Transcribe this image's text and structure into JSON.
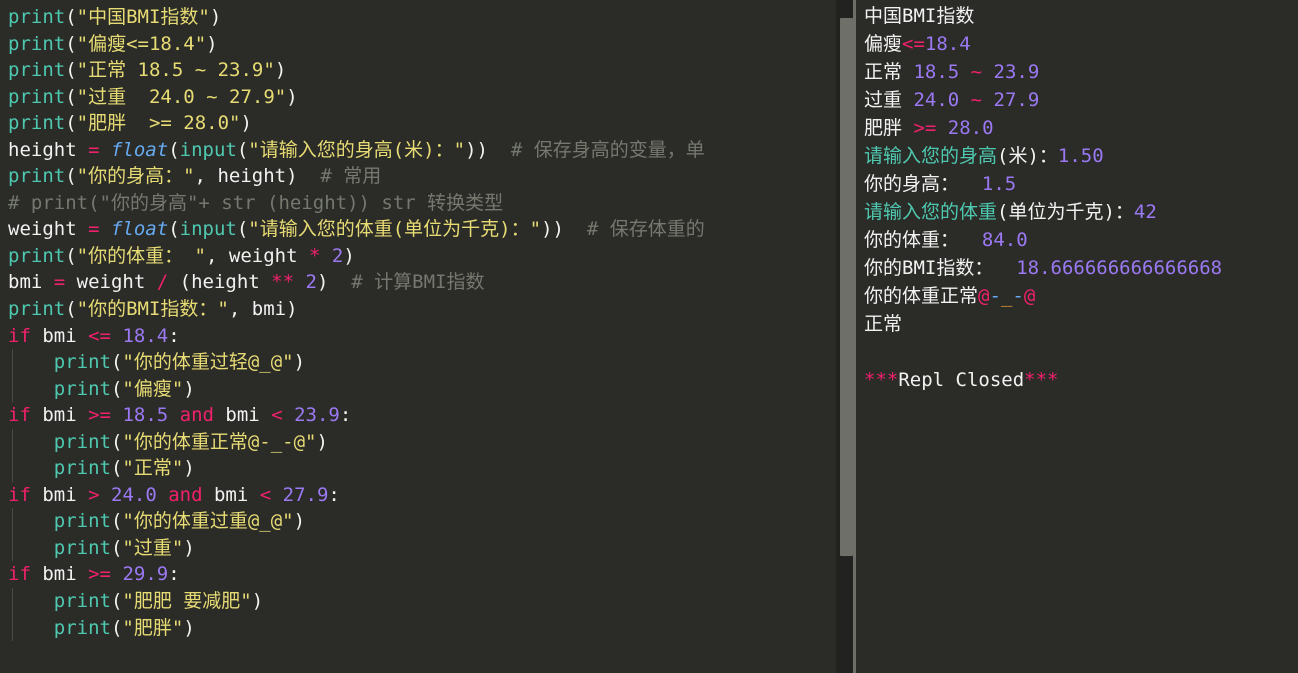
{
  "window": {
    "theme": "dark",
    "colors": {
      "background": "#2b2b28",
      "function": "#4ec9b0",
      "string": "#e7db74",
      "number": "#9a79f2",
      "operator": "#f0216c",
      "comment": "#74786e",
      "cast": "#66aaf0",
      "text": "#f2f2f2",
      "scrollbar": "#6f6f69"
    }
  },
  "editor": {
    "name": "python-code-editor",
    "language": "Python",
    "lines": [
      {
        "n": 1,
        "indent": 0,
        "tokens": [
          {
            "c": "fn",
            "t": "print"
          },
          {
            "c": "punc",
            "t": "("
          },
          {
            "c": "str",
            "t": "\"中国BMI指数\""
          },
          {
            "c": "punc",
            "t": ")"
          }
        ]
      },
      {
        "n": 2,
        "indent": 0,
        "tokens": [
          {
            "c": "fn",
            "t": "print"
          },
          {
            "c": "punc",
            "t": "("
          },
          {
            "c": "str",
            "t": "\"偏瘦<=18.4\""
          },
          {
            "c": "punc",
            "t": ")"
          }
        ]
      },
      {
        "n": 3,
        "indent": 0,
        "tokens": [
          {
            "c": "fn",
            "t": "print"
          },
          {
            "c": "punc",
            "t": "("
          },
          {
            "c": "str",
            "t": "\"正常 18.5 ~ 23.9\""
          },
          {
            "c": "punc",
            "t": ")"
          }
        ]
      },
      {
        "n": 4,
        "indent": 0,
        "tokens": [
          {
            "c": "fn",
            "t": "print"
          },
          {
            "c": "punc",
            "t": "("
          },
          {
            "c": "str",
            "t": "\"过重  24.0 ~ 27.9\""
          },
          {
            "c": "punc",
            "t": ")"
          }
        ]
      },
      {
        "n": 5,
        "indent": 0,
        "tokens": [
          {
            "c": "fn",
            "t": "print"
          },
          {
            "c": "punc",
            "t": "("
          },
          {
            "c": "str",
            "t": "\"肥胖  >= 28.0\""
          },
          {
            "c": "punc",
            "t": ")"
          }
        ]
      },
      {
        "n": 6,
        "indent": 0,
        "tokens": [
          {
            "c": "var",
            "t": "height "
          },
          {
            "c": "op",
            "t": "="
          },
          {
            "c": "plain",
            "t": " "
          },
          {
            "c": "cast",
            "t": "float"
          },
          {
            "c": "punc",
            "t": "("
          },
          {
            "c": "fn",
            "t": "input"
          },
          {
            "c": "punc",
            "t": "("
          },
          {
            "c": "str",
            "t": "\"请输入您的身高(米)："
          },
          {
            "c": "str",
            "t": "\""
          },
          {
            "c": "punc",
            "t": "))"
          },
          {
            "c": "cmt",
            "t": "  # 保存身高的变量，单"
          }
        ]
      },
      {
        "n": 7,
        "indent": 0,
        "tokens": [
          {
            "c": "fn",
            "t": "print"
          },
          {
            "c": "punc",
            "t": "("
          },
          {
            "c": "str",
            "t": "\"你的身高：\""
          },
          {
            "c": "punc",
            "t": ", "
          },
          {
            "c": "var",
            "t": "height"
          },
          {
            "c": "punc",
            "t": ")"
          },
          {
            "c": "cmt",
            "t": "  # 常用"
          }
        ]
      },
      {
        "n": 8,
        "indent": 0,
        "tokens": [
          {
            "c": "cmt",
            "t": "# print(\"你的身高\"+ str (height)) str 转换类型"
          }
        ]
      },
      {
        "n": 9,
        "indent": 0,
        "tokens": [
          {
            "c": "var",
            "t": "weight "
          },
          {
            "c": "op",
            "t": "="
          },
          {
            "c": "plain",
            "t": " "
          },
          {
            "c": "cast",
            "t": "float"
          },
          {
            "c": "punc",
            "t": "("
          },
          {
            "c": "fn",
            "t": "input"
          },
          {
            "c": "punc",
            "t": "("
          },
          {
            "c": "str",
            "t": "\"请输入您的体重(单位为千克)：\""
          },
          {
            "c": "punc",
            "t": "))"
          },
          {
            "c": "cmt",
            "t": "  # 保存体重的"
          }
        ]
      },
      {
        "n": 10,
        "indent": 0,
        "tokens": [
          {
            "c": "fn",
            "t": "print"
          },
          {
            "c": "punc",
            "t": "("
          },
          {
            "c": "str",
            "t": "\"你的体重： \""
          },
          {
            "c": "punc",
            "t": ", "
          },
          {
            "c": "var",
            "t": "weight "
          },
          {
            "c": "op",
            "t": "*"
          },
          {
            "c": "plain",
            "t": " "
          },
          {
            "c": "num",
            "t": "2"
          },
          {
            "c": "punc",
            "t": ")"
          }
        ]
      },
      {
        "n": 11,
        "indent": 0,
        "tokens": [
          {
            "c": "var",
            "t": "bmi "
          },
          {
            "c": "op",
            "t": "="
          },
          {
            "c": "var",
            "t": " weight "
          },
          {
            "c": "op",
            "t": "/"
          },
          {
            "c": "punc",
            "t": " ("
          },
          {
            "c": "var",
            "t": "height "
          },
          {
            "c": "op",
            "t": "**"
          },
          {
            "c": "plain",
            "t": " "
          },
          {
            "c": "num",
            "t": "2"
          },
          {
            "c": "punc",
            "t": ")"
          },
          {
            "c": "cmt",
            "t": "  # 计算BMI指数"
          }
        ]
      },
      {
        "n": 12,
        "indent": 0,
        "tokens": [
          {
            "c": "fn",
            "t": "print"
          },
          {
            "c": "punc",
            "t": "("
          },
          {
            "c": "str",
            "t": "\"你的BMI指数：\""
          },
          {
            "c": "punc",
            "t": ", "
          },
          {
            "c": "var",
            "t": "bmi"
          },
          {
            "c": "punc",
            "t": ")"
          }
        ]
      },
      {
        "n": 13,
        "indent": 0,
        "tokens": [
          {
            "c": "kw",
            "t": "if"
          },
          {
            "c": "var",
            "t": " bmi "
          },
          {
            "c": "op",
            "t": "<="
          },
          {
            "c": "plain",
            "t": " "
          },
          {
            "c": "num",
            "t": "18.4"
          },
          {
            "c": "punc",
            "t": ":"
          }
        ]
      },
      {
        "n": 14,
        "indent": 1,
        "tokens": [
          {
            "c": "plain",
            "t": "    "
          },
          {
            "c": "fn",
            "t": "print"
          },
          {
            "c": "punc",
            "t": "("
          },
          {
            "c": "str",
            "t": "\"你的体重过轻@_@\""
          },
          {
            "c": "punc",
            "t": ")"
          }
        ]
      },
      {
        "n": 15,
        "indent": 1,
        "tokens": [
          {
            "c": "plain",
            "t": "    "
          },
          {
            "c": "fn",
            "t": "print"
          },
          {
            "c": "punc",
            "t": "("
          },
          {
            "c": "str",
            "t": "\"偏瘦\""
          },
          {
            "c": "punc",
            "t": ")"
          }
        ]
      },
      {
        "n": 16,
        "indent": 0,
        "tokens": [
          {
            "c": "kw",
            "t": "if"
          },
          {
            "c": "var",
            "t": " bmi "
          },
          {
            "c": "op",
            "t": ">="
          },
          {
            "c": "plain",
            "t": " "
          },
          {
            "c": "num",
            "t": "18.5"
          },
          {
            "c": "plain",
            "t": " "
          },
          {
            "c": "kw",
            "t": "and"
          },
          {
            "c": "var",
            "t": " bmi "
          },
          {
            "c": "op",
            "t": "<"
          },
          {
            "c": "plain",
            "t": " "
          },
          {
            "c": "num",
            "t": "23.9"
          },
          {
            "c": "punc",
            "t": ":"
          }
        ]
      },
      {
        "n": 17,
        "indent": 1,
        "tokens": [
          {
            "c": "plain",
            "t": "    "
          },
          {
            "c": "fn",
            "t": "print"
          },
          {
            "c": "punc",
            "t": "("
          },
          {
            "c": "str",
            "t": "\"你的体重正常@-_-@\""
          },
          {
            "c": "punc",
            "t": ")"
          }
        ]
      },
      {
        "n": 18,
        "indent": 1,
        "tokens": [
          {
            "c": "plain",
            "t": "    "
          },
          {
            "c": "fn",
            "t": "print"
          },
          {
            "c": "punc",
            "t": "("
          },
          {
            "c": "str",
            "t": "\"正常\""
          },
          {
            "c": "punc",
            "t": ")"
          }
        ]
      },
      {
        "n": 19,
        "indent": 0,
        "tokens": [
          {
            "c": "kw",
            "t": "if"
          },
          {
            "c": "var",
            "t": " bmi "
          },
          {
            "c": "op",
            "t": ">"
          },
          {
            "c": "plain",
            "t": " "
          },
          {
            "c": "num",
            "t": "24.0"
          },
          {
            "c": "plain",
            "t": " "
          },
          {
            "c": "kw",
            "t": "and"
          },
          {
            "c": "var",
            "t": " bmi "
          },
          {
            "c": "op",
            "t": "<"
          },
          {
            "c": "plain",
            "t": " "
          },
          {
            "c": "num",
            "t": "27.9"
          },
          {
            "c": "punc",
            "t": ":"
          }
        ]
      },
      {
        "n": 20,
        "indent": 1,
        "tokens": [
          {
            "c": "plain",
            "t": "    "
          },
          {
            "c": "fn",
            "t": "print"
          },
          {
            "c": "punc",
            "t": "("
          },
          {
            "c": "str",
            "t": "\"你的体重过重@_@\""
          },
          {
            "c": "punc",
            "t": ")"
          }
        ]
      },
      {
        "n": 21,
        "indent": 1,
        "tokens": [
          {
            "c": "plain",
            "t": "    "
          },
          {
            "c": "fn",
            "t": "print"
          },
          {
            "c": "punc",
            "t": "("
          },
          {
            "c": "str",
            "t": "\"过重\""
          },
          {
            "c": "punc",
            "t": ")"
          }
        ]
      },
      {
        "n": 22,
        "indent": 0,
        "tokens": [
          {
            "c": "kw",
            "t": "if"
          },
          {
            "c": "var",
            "t": " bmi "
          },
          {
            "c": "op",
            "t": ">="
          },
          {
            "c": "plain",
            "t": " "
          },
          {
            "c": "num",
            "t": "29.9"
          },
          {
            "c": "punc",
            "t": ":"
          }
        ]
      },
      {
        "n": 23,
        "indent": 1,
        "tokens": [
          {
            "c": "plain",
            "t": "    "
          },
          {
            "c": "fn",
            "t": "print"
          },
          {
            "c": "punc",
            "t": "("
          },
          {
            "c": "str",
            "t": "\"肥肥 要减肥\""
          },
          {
            "c": "punc",
            "t": ")"
          }
        ]
      },
      {
        "n": 24,
        "indent": 1,
        "tokens": [
          {
            "c": "plain",
            "t": "    "
          },
          {
            "c": "fn",
            "t": "print"
          },
          {
            "c": "punc",
            "t": "("
          },
          {
            "c": "str",
            "t": "\"肥胖\""
          },
          {
            "c": "punc",
            "t": ")"
          }
        ]
      }
    ]
  },
  "console": {
    "name": "repl-output-panel",
    "lines": [
      {
        "n": 1,
        "tokens": [
          {
            "c": "white",
            "t": "中国BMI指数"
          }
        ]
      },
      {
        "n": 2,
        "tokens": [
          {
            "c": "white",
            "t": "偏瘦"
          },
          {
            "c": "op",
            "t": "<="
          },
          {
            "c": "num",
            "t": "18.4"
          }
        ]
      },
      {
        "n": 3,
        "tokens": [
          {
            "c": "white",
            "t": "正常 "
          },
          {
            "c": "num",
            "t": "18.5"
          },
          {
            "c": "op",
            "t": " ~ "
          },
          {
            "c": "num",
            "t": "23.9"
          }
        ]
      },
      {
        "n": 4,
        "tokens": [
          {
            "c": "white",
            "t": "过重 "
          },
          {
            "c": "num",
            "t": "24.0"
          },
          {
            "c": "op",
            "t": " ~ "
          },
          {
            "c": "num",
            "t": "27.9"
          }
        ]
      },
      {
        "n": 5,
        "tokens": [
          {
            "c": "white",
            "t": "肥胖 "
          },
          {
            "c": "op",
            "t": ">="
          },
          {
            "c": "num",
            "t": " 28.0"
          }
        ]
      },
      {
        "n": 6,
        "tokens": [
          {
            "c": "prompt",
            "t": "请输入您的身高"
          },
          {
            "c": "white",
            "t": "(米)："
          },
          {
            "c": "num",
            "t": "1.50"
          }
        ]
      },
      {
        "n": 7,
        "tokens": [
          {
            "c": "white",
            "t": "你的身高： "
          },
          {
            "c": "num",
            "t": " 1.5"
          }
        ]
      },
      {
        "n": 8,
        "tokens": [
          {
            "c": "prompt",
            "t": "请输入您的体重"
          },
          {
            "c": "white",
            "t": "(单位为千克)："
          },
          {
            "c": "num",
            "t": "42"
          }
        ]
      },
      {
        "n": 9,
        "tokens": [
          {
            "c": "white",
            "t": "你的体重：  "
          },
          {
            "c": "num",
            "t": "84.0"
          }
        ]
      },
      {
        "n": 10,
        "tokens": [
          {
            "c": "white",
            "t": "你的BMI指数： "
          },
          {
            "c": "num",
            "t": " 18.666666666666668"
          }
        ]
      },
      {
        "n": 11,
        "tokens": [
          {
            "c": "white",
            "t": "你的体重正常"
          },
          {
            "c": "at",
            "t": "@"
          },
          {
            "c": "dash",
            "t": "-"
          },
          {
            "c": "und",
            "t": "_"
          },
          {
            "c": "dash",
            "t": "-"
          },
          {
            "c": "at",
            "t": "@"
          }
        ]
      },
      {
        "n": 12,
        "tokens": [
          {
            "c": "white",
            "t": "正常"
          }
        ]
      },
      {
        "n": 13,
        "tokens": []
      },
      {
        "n": 14,
        "tokens": [
          {
            "c": "star",
            "t": "***"
          },
          {
            "c": "white",
            "t": "Repl Closed"
          },
          {
            "c": "star",
            "t": "***"
          }
        ]
      }
    ]
  },
  "scrollbars": {
    "editor_vertical": {
      "name": "editor-vertical-scrollbar"
    },
    "console_horizontal": {
      "name": "console-horizontal-scrollbar"
    }
  }
}
